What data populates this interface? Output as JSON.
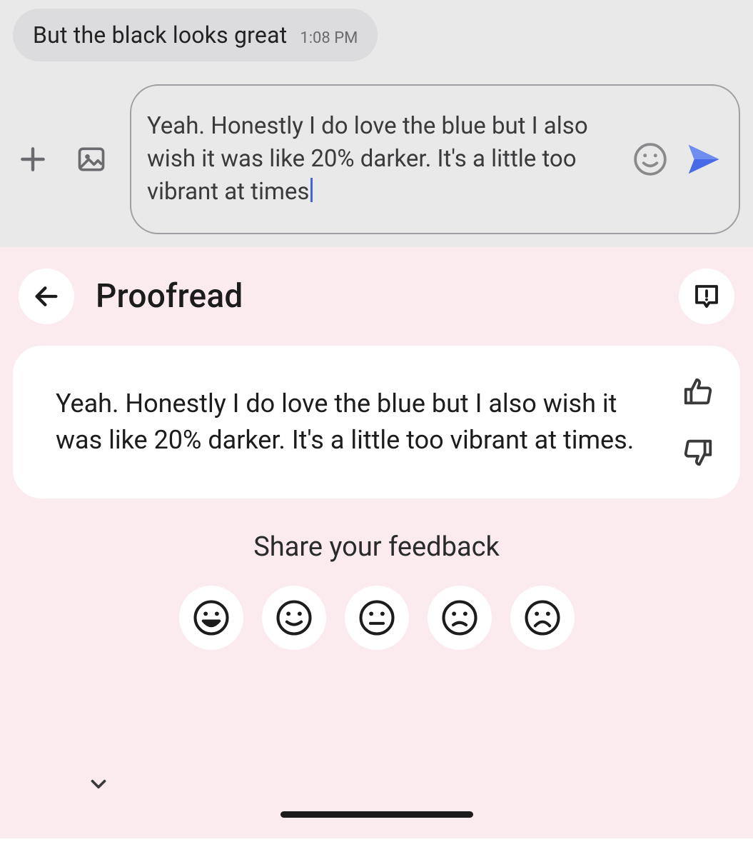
{
  "chat": {
    "received": {
      "text": "But the black looks great",
      "time": "1:08 PM"
    },
    "compose": {
      "draft": "Yeah. Honestly I do love the blue but I also wish it was like 20% darker. It's a little too vibrant at times"
    }
  },
  "proofread": {
    "title": "Proofread",
    "suggestion": "Yeah. Honestly I do love the blue but I also wish it was like 20% darker. It's a little too vibrant at times.",
    "feedback_prompt": "Share your feedback",
    "feedback_faces": [
      "very-happy",
      "happy",
      "neutral",
      "slightly-sad",
      "sad"
    ]
  }
}
